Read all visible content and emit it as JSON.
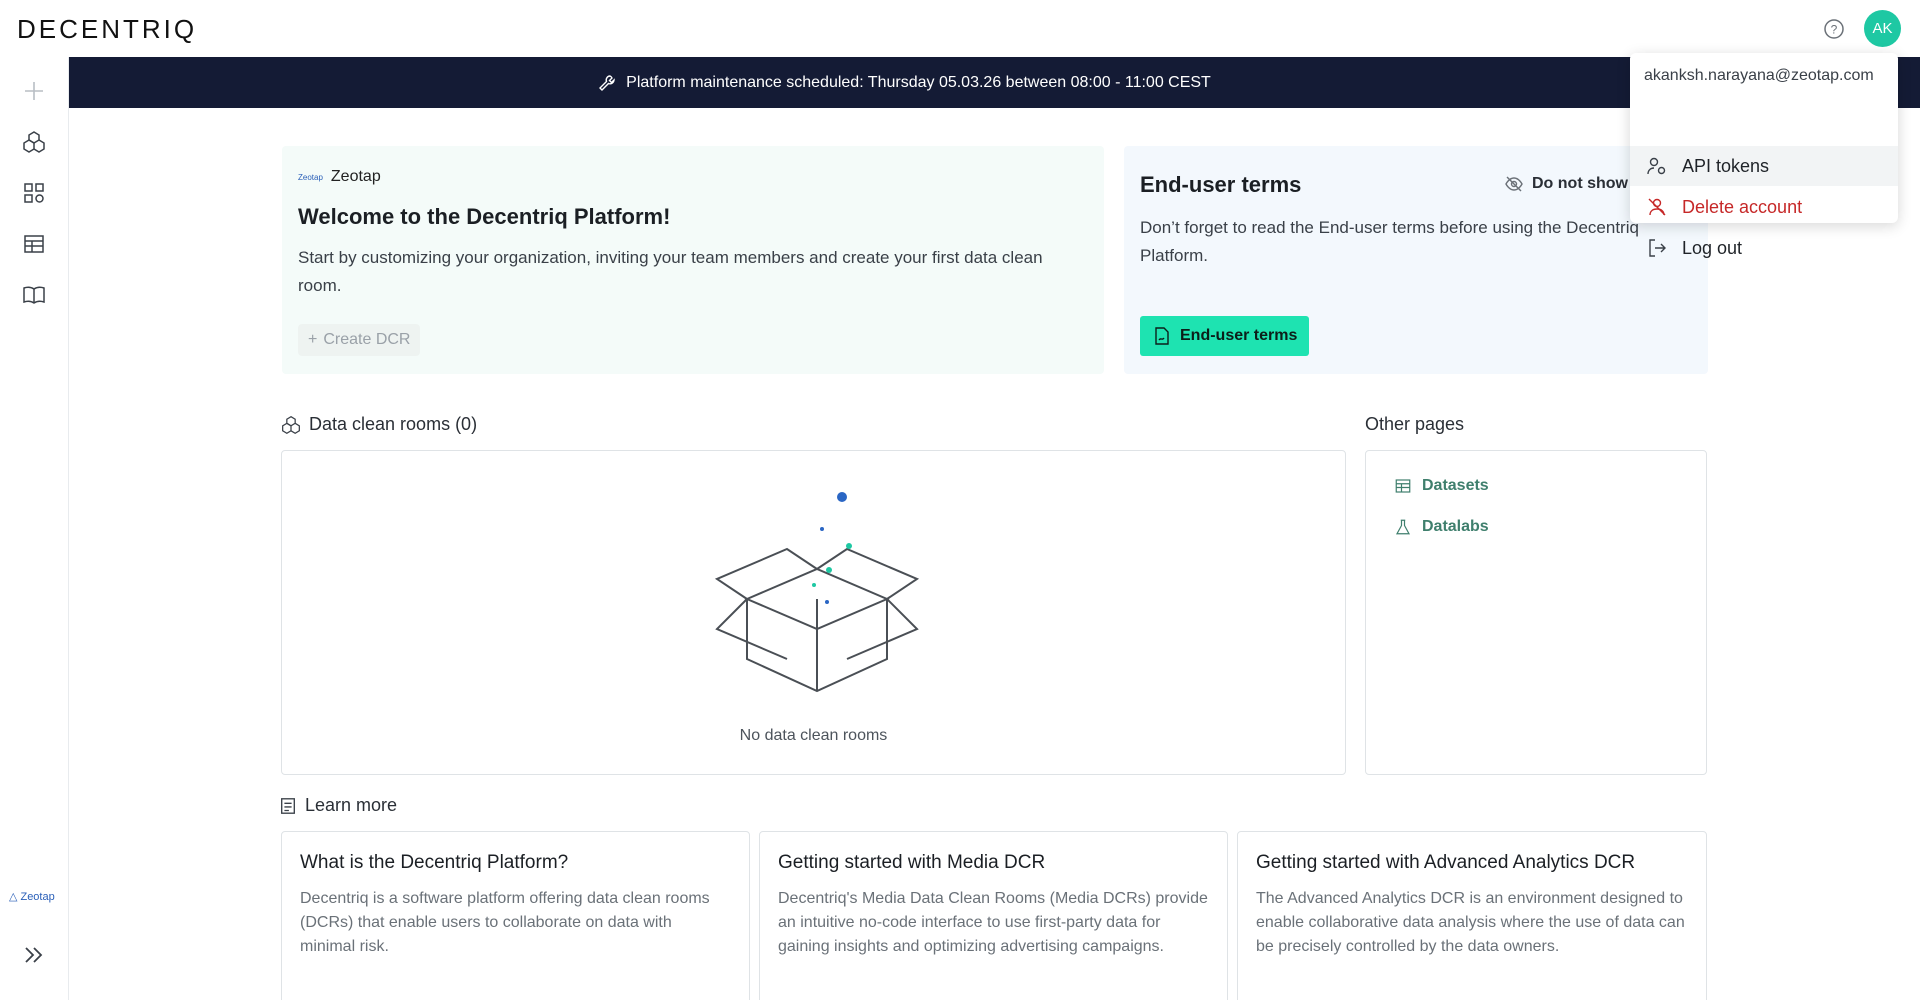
{
  "app": {
    "logo": "DECENTRIQ",
    "avatar_initials": "AK",
    "accent": "#1ec8a3"
  },
  "banner": {
    "text": "Platform maintenance scheduled: Thursday 05.03.26 between 08:00 - 11:00 CEST"
  },
  "sidebar": {
    "brand": "Zeotap",
    "items": [
      "plus-icon",
      "cubes-icon",
      "apps-icon",
      "table-icon",
      "book-icon"
    ]
  },
  "welcome": {
    "org": "Zeotap",
    "org_mini": "Zeotap",
    "title": "Welcome to the Decentriq Platform!",
    "body": "Start by customizing your organization, inviting your team members and create your first data clean room.",
    "create_label": "Create DCR"
  },
  "terms": {
    "title": "End-user terms",
    "dont_show": "Do not show",
    "body": "Don’t forget to read the End-user terms before using the Decentriq Platform.",
    "button": "End-user terms"
  },
  "menu": {
    "email": "akanksh.narayana@zeotap.com",
    "items": [
      {
        "label": "API tokens"
      },
      {
        "label": "Delete account",
        "color": "#c62828"
      },
      {
        "label": "Log out"
      }
    ]
  },
  "dcr": {
    "title": "Data clean rooms (0)",
    "empty": "No data clean rooms"
  },
  "other": {
    "title": "Other pages",
    "links": [
      "Datasets",
      "Datalabs"
    ]
  },
  "learn": {
    "title": "Learn more",
    "cards": [
      {
        "title": "What is the Decentriq Platform?",
        "body": "Decentriq is a software platform offering data clean rooms (DCRs) that enable users to collaborate on data with minimal risk."
      },
      {
        "title": "Getting started with Media DCR",
        "body": "Decentriq's Media Data Clean Rooms (Media DCRs) provide an intuitive no-code interface to use first-party data for gaining insights and optimizing advertising campaigns."
      },
      {
        "title": "Getting started with Advanced Analytics DCR",
        "body": "The Advanced Analytics DCR is an environment designed to enable collaborative data analysis where the use of data can be precisely controlled by the data owners."
      }
    ]
  }
}
